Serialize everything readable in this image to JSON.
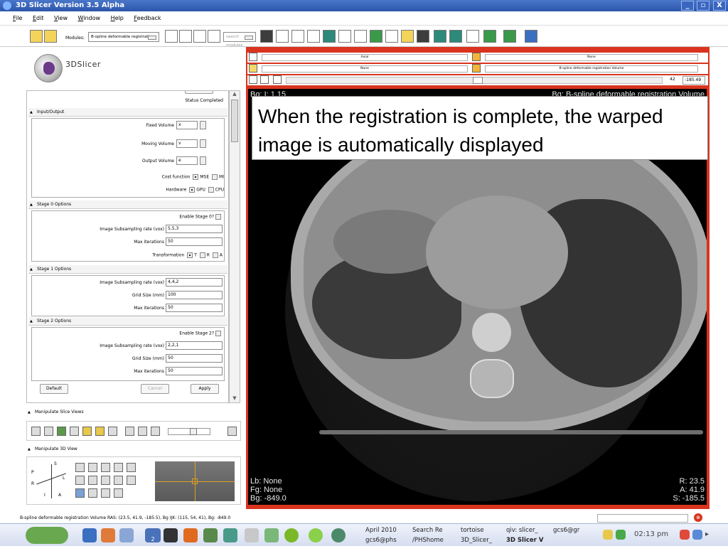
{
  "window": {
    "title": "3D Slicer Version 3.5 Alpha",
    "controls": [
      "_",
      "▫",
      "X"
    ]
  },
  "menu": [
    "File",
    "Edit",
    "View",
    "Window",
    "Help",
    "Feedback"
  ],
  "toolbar": {
    "modules_label": "Modules:",
    "module_selected": "B-spline deformable registration",
    "search_placeholder": "search modules"
  },
  "logo": {
    "text": "3DSlicer"
  },
  "module": {
    "status_label": "Status",
    "status_value": "Completed",
    "io": {
      "header": "Input/Output",
      "fixed_label": "Fixed Volume",
      "fixed_value": "x",
      "moving_label": "Moving Volume",
      "moving_value": "v",
      "output_label": "Output Volume",
      "output_value": "e",
      "cost_label": "Cost function",
      "cost_opt1": "MSE",
      "cost_opt2": "MI",
      "hw_label": "Hardware",
      "hw_opt1": "GPU",
      "hw_opt2": "CPU"
    },
    "stage0": {
      "header": "Stage 0 Options",
      "enable_label": "Enable Stage 0?",
      "subsample_label": "Image Subsampling rate (vox)",
      "subsample_value": "5,5,3",
      "iter_label": "Max iterations",
      "iter_value": "50",
      "trans_label": "Transformation",
      "trans_t": "T",
      "trans_r": "R",
      "trans_a": "A"
    },
    "stage1": {
      "header": "Stage 1 Options",
      "subsample_label": "Image Subsampling rate (vox)",
      "subsample_value": "4,4,2",
      "grid_label": "Grid Size (mm)",
      "grid_value": "100",
      "iter_label": "Max iterations",
      "iter_value": "50"
    },
    "stage2": {
      "header": "Stage 2 Options",
      "enable_label": "Enable Stage 2?",
      "subsample_label": "Image Subsampling rate (vox)",
      "subsample_value": "2,2,1",
      "grid_label": "Grid Size (mm)",
      "grid_value": "50",
      "iter_label": "Max iterations",
      "iter_value": "50"
    },
    "buttons": {
      "default": "Default",
      "cancel": "Cancel",
      "apply": "Apply"
    }
  },
  "manip_slice": {
    "header": "Manipulate Slice Views"
  },
  "manip_3d": {
    "header": "Manipulate 3D View",
    "axes": [
      "P",
      "S",
      "L",
      "R",
      "I",
      "A"
    ]
  },
  "viewer": {
    "row1_left": "Axial",
    "row1_right": "None",
    "row2_left": "None",
    "row2_right": "B-spline deformable registration Volume",
    "slider_value": "42",
    "offset_value": "-185.49",
    "top_left": "Bg: I: 1.15",
    "top_right": "Bg: B-spline deformable registration Volume",
    "bottom_left": [
      "Lb: None",
      "Fg: None",
      "Bg: -849.0"
    ],
    "bottom_right": [
      "R: 23.5",
      "A: 41.9",
      "S: -185.5"
    ]
  },
  "caption": "When the registration is complete, the warped image is automatically displayed",
  "status_bar": "B-spline deformable registration Volume RAS: (23.5, 41.9, -185.5), Bg IJK: (115, 54, 41), Bg: -849.0",
  "taskbar": {
    "workspace": "2",
    "tasks_top": [
      "April 2010",
      "Search Re",
      "tortoise",
      "qiv: slicer_",
      "gcs6@gr"
    ],
    "tasks_bottom": [
      "gcs6@phs",
      "/PHShome",
      "3D_Slicer_",
      "3D Slicer V"
    ],
    "clock": "02:13 pm"
  },
  "colors": {
    "viewer_border": "#d9341f",
    "titlebar": "#2b56ab"
  }
}
